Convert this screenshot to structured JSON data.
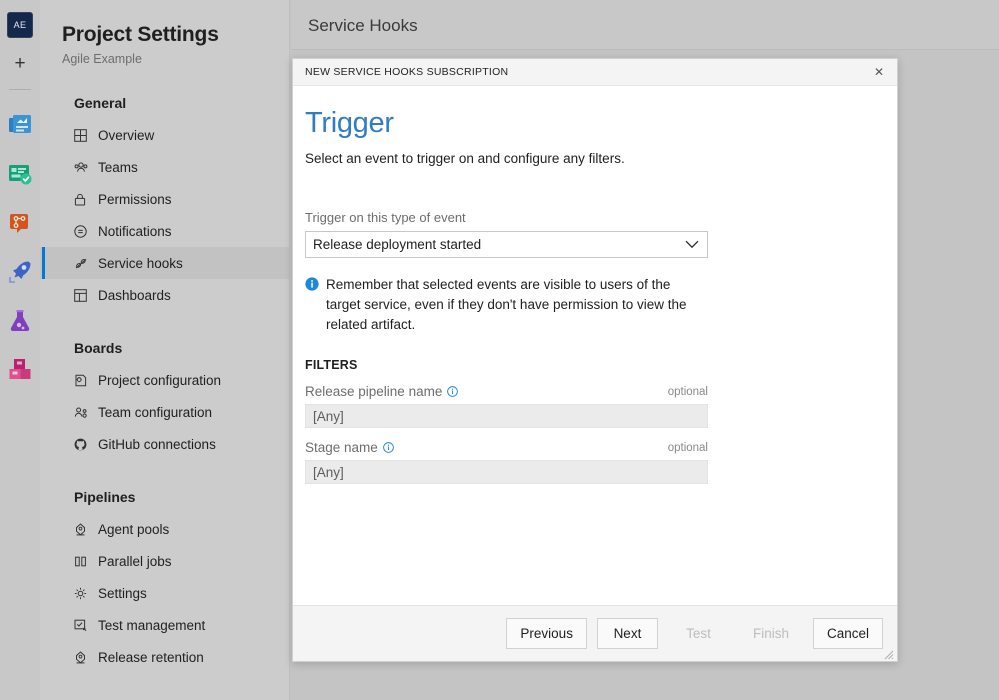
{
  "rail": {
    "avatar_label": "AE",
    "add_label": "+",
    "icons": [
      {
        "name": "overview-icon",
        "color": "#3c94d6"
      },
      {
        "name": "boards-icon",
        "color": "#1a9e7a"
      },
      {
        "name": "repos-icon",
        "color": "#d4541f"
      },
      {
        "name": "pipelines-icon",
        "color": "#3d63c9"
      },
      {
        "name": "test-plans-icon",
        "color": "#7f3fbf"
      },
      {
        "name": "artifacts-icon",
        "color": "#c8307a"
      }
    ]
  },
  "sidebar": {
    "title": "Project Settings",
    "subtitle": "Agile Example",
    "groups": [
      {
        "label": "General",
        "items": [
          {
            "label": "Overview",
            "icon": "grid-icon",
            "glyph": "⊞",
            "selected": false
          },
          {
            "label": "Teams",
            "icon": "teams-icon",
            "glyph": "ʘ",
            "selected": false
          },
          {
            "label": "Permissions",
            "icon": "lock-icon",
            "glyph": "ὑ2",
            "selected": false
          },
          {
            "label": "Notifications",
            "icon": "bell-icon",
            "glyph": "⊙",
            "selected": false
          },
          {
            "label": "Service hooks",
            "icon": "service-hooks-icon",
            "glyph": "⌗",
            "selected": true
          },
          {
            "label": "Dashboards",
            "icon": "dashboard-icon",
            "glyph": "⊞",
            "selected": false
          }
        ]
      },
      {
        "label": "Boards",
        "items": [
          {
            "label": "Project configuration",
            "icon": "config-icon",
            "glyph": "⚙",
            "selected": false
          },
          {
            "label": "Team configuration",
            "icon": "team-config-icon",
            "glyph": "ʘ",
            "selected": false
          },
          {
            "label": "GitHub connections",
            "icon": "github-icon",
            "glyph": "●",
            "selected": false
          }
        ]
      },
      {
        "label": "Pipelines",
        "items": [
          {
            "label": "Agent pools",
            "icon": "agent-pool-icon",
            "glyph": "⚙",
            "selected": false
          },
          {
            "label": "Parallel jobs",
            "icon": "parallel-jobs-icon",
            "glyph": "‖",
            "selected": false
          },
          {
            "label": "Settings",
            "icon": "gear-icon",
            "glyph": "⚙",
            "selected": false
          },
          {
            "label": "Test management",
            "icon": "test-management-icon",
            "glyph": "☑",
            "selected": false
          },
          {
            "label": "Release retention",
            "icon": "release-retention-icon",
            "glyph": "⚙",
            "selected": false
          }
        ]
      }
    ]
  },
  "main": {
    "header_title": "Service Hooks"
  },
  "dialog": {
    "titlebar": "NEW SERVICE HOOKS SUBSCRIPTION",
    "close_glyph": "✕",
    "heading": "Trigger",
    "description": "Select an event to trigger on and configure any filters.",
    "event_field": {
      "label": "Trigger on this type of event",
      "value": "Release deployment started",
      "chevron": "∨"
    },
    "note": {
      "icon": "info-icon",
      "text": "Remember that selected events are visible to users of the target service, even if they don't have permission to view the related artifact."
    },
    "filters_heading": "FILTERS",
    "filters": [
      {
        "label": "Release pipeline name",
        "optional_label": "optional",
        "value": "[Any]",
        "placeholder": "[Any]",
        "info_icon": "info-icon"
      },
      {
        "label": "Stage name",
        "optional_label": "optional",
        "value": "[Any]",
        "placeholder": "[Any]",
        "info_icon": "info-icon"
      }
    ],
    "buttons": [
      {
        "label": "Previous",
        "disabled": false
      },
      {
        "label": "Next",
        "disabled": false
      },
      {
        "label": "Test",
        "disabled": true
      },
      {
        "label": "Finish",
        "disabled": true
      },
      {
        "label": "Cancel",
        "disabled": false
      }
    ],
    "resize_grip": "resize-grip-icon"
  },
  "colors": {
    "accent": "#0078d4",
    "heading": "#327dc2",
    "info": "#1e88d8",
    "page_bg": "#c4c4c4"
  }
}
